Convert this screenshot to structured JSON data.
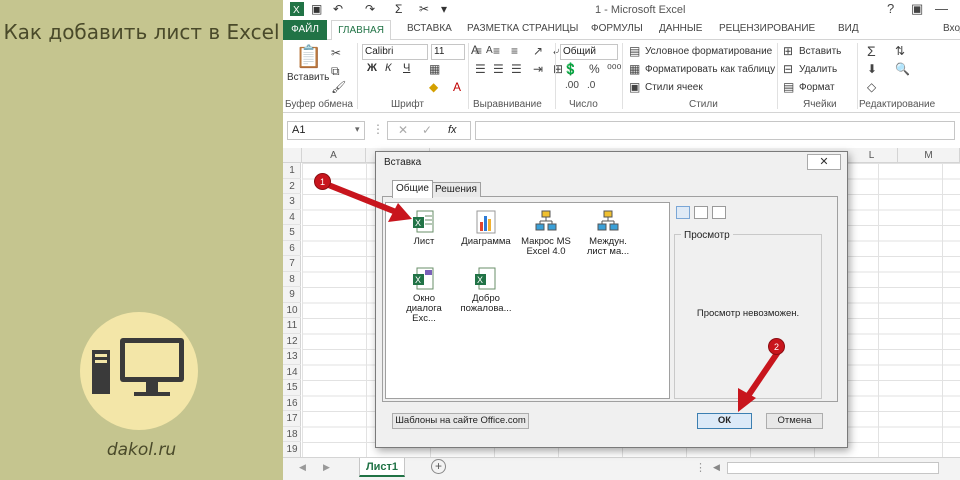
{
  "banner": {
    "title": "Как добавить лист в Excel",
    "site": "dakol.ru"
  },
  "window": {
    "title": "1 - Microsoft Excel",
    "help": "?",
    "login": "Вход"
  },
  "ribbon_tabs": {
    "file": "ФАЙЛ",
    "home": "ГЛАВНАЯ",
    "insert": "ВСТАВКА",
    "page_layout": "РАЗМЕТКА СТРАНИЦЫ",
    "formulas": "ФОРМУЛЫ",
    "data": "ДАННЫЕ",
    "review": "РЕЦЕНЗИРОВАНИЕ",
    "view": "ВИД"
  },
  "ribbon": {
    "paste": "Вставить",
    "font_name": "Calibri",
    "font_size": "11",
    "bold": "Ж",
    "italic": "К",
    "underline": "Ч",
    "number_format": "Общий",
    "cond_format": "Условное форматирование",
    "format_table": "Форматировать как таблицу",
    "cell_styles": "Стили ячеек",
    "insert_cells": "Вставить",
    "delete_cells": "Удалить",
    "format_cells": "Формат",
    "groups": {
      "clipboard": "Буфер обмена",
      "font": "Шрифт",
      "alignment": "Выравнивание",
      "number": "Число",
      "styles": "Стили",
      "cells": "Ячейки",
      "editing": "Редактирование"
    }
  },
  "formula_bar": {
    "name_box": "A1",
    "fx": "fx"
  },
  "grid": {
    "columns": [
      "A",
      "L",
      "M"
    ],
    "rows": [
      "1",
      "2",
      "3",
      "4",
      "5",
      "6",
      "7",
      "8",
      "9",
      "10",
      "11",
      "12",
      "13",
      "14",
      "15",
      "16",
      "17",
      "18",
      "19"
    ]
  },
  "sheets": {
    "active": "Лист1",
    "add": "+"
  },
  "dialog": {
    "title": "Вставка",
    "close": "✕",
    "tabs": [
      "Общие",
      "Решения"
    ],
    "items": [
      {
        "label": "Лист"
      },
      {
        "label": "Диаграмма"
      },
      {
        "label": "Макрос MS Excel 4.0"
      },
      {
        "label": "Междун. лист ма..."
      },
      {
        "label": "Окно диалога Exc..."
      },
      {
        "label": "Добро пожалова..."
      }
    ],
    "preview_label": "Просмотр",
    "preview_text": "Просмотр невозможен.",
    "templates_button": "Шаблоны на сайте Office.com",
    "ok_button": "ОК",
    "cancel_button": "Отмена"
  },
  "annotations": {
    "step1": "1",
    "step2": "2",
    "arrow_color": "#c8151d"
  },
  "colors": {
    "excel_green": "#217346",
    "banner_bg": "#c5c58f"
  }
}
